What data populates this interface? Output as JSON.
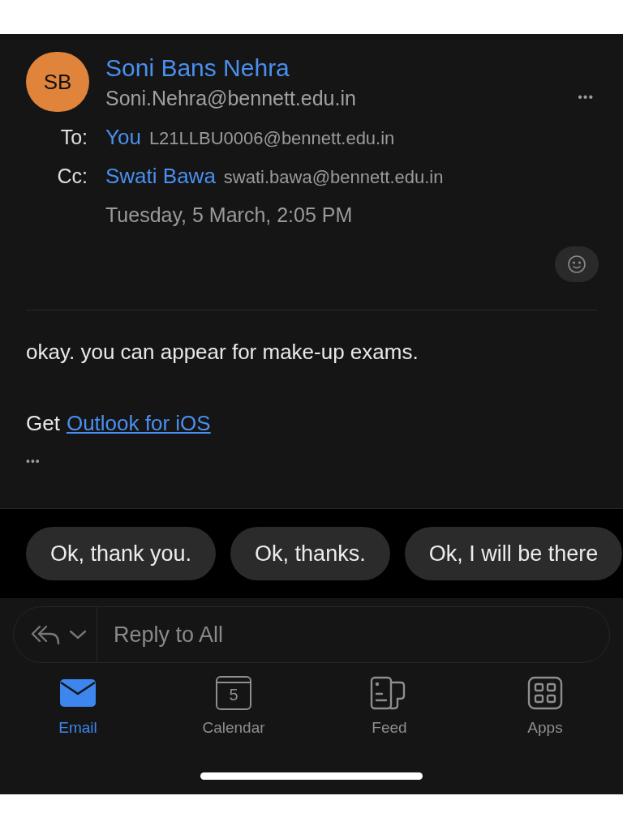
{
  "sender": {
    "initials": "SB",
    "name": "Soni Bans Nehra",
    "email": "Soni.Nehra@bennett.edu.in"
  },
  "more_button": "•••",
  "recipients": [
    {
      "label": "To:",
      "name": "You",
      "email": "L21LLBU0006@bennett.edu.in"
    },
    {
      "label": "Cc:",
      "name": "Swati Bawa",
      "email": "swati.bawa@bennett.edu.in"
    }
  ],
  "date": "Tuesday, 5 March, 2:05 PM",
  "body": "okay. you can appear for make-up exams.",
  "signature": {
    "prefix": "Get",
    "link": "Outlook for iOS"
  },
  "trimmed_content": "•••",
  "quick_replies": [
    "Ok, thank you.",
    "Ok, thanks.",
    "Ok, I will be there"
  ],
  "reply": {
    "placeholder": "Reply to All"
  },
  "tabs": [
    {
      "label": "Email",
      "kind": "email",
      "selected": true
    },
    {
      "label": "Calendar",
      "kind": "calendar",
      "badge": "5",
      "selected": false
    },
    {
      "label": "Feed",
      "kind": "feed",
      "selected": false
    },
    {
      "label": "Apps",
      "kind": "apps",
      "selected": false
    }
  ]
}
